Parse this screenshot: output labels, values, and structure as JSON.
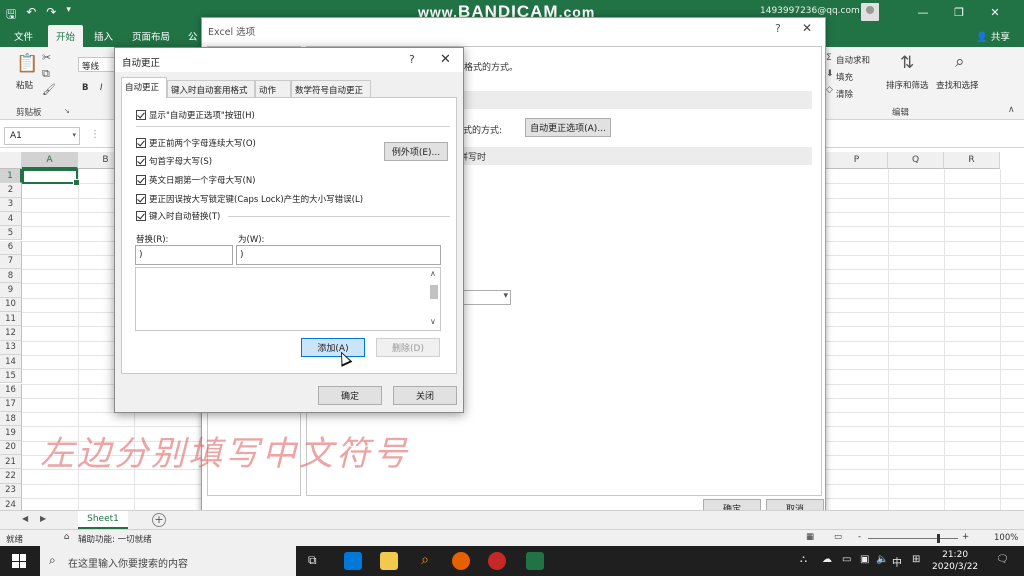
{
  "watermark": {
    "prefix": "www.",
    "brand": "BANDICAM",
    "suffix": ".com"
  },
  "account": "1493997236@qq.com",
  "window_buttons": [
    "—",
    "❐",
    "✕"
  ],
  "ribbon": {
    "tabs": [
      "文件",
      "开始",
      "插入",
      "页面布局",
      "公"
    ],
    "share": "共享",
    "paste": "粘贴",
    "clipboard_label": "剪贴板",
    "font_name": "等线",
    "autosum": "自动求和",
    "fill": "填充",
    "clear": "清除",
    "sort_filter": "排序和筛选",
    "find_select": "查找和选择",
    "editing_label": "编辑",
    "bold": "B",
    "italic": "I"
  },
  "formula_bar": {
    "name_box": "A1"
  },
  "grid": {
    "columns_left": [
      "A",
      "B"
    ],
    "columns_right": [
      "P",
      "Q",
      "R"
    ],
    "rows": [
      "1",
      "2",
      "3",
      "4",
      "5",
      "6",
      "7",
      "8",
      "9",
      "10",
      "11",
      "12",
      "13",
      "14",
      "15",
      "16",
      "17",
      "18",
      "19",
      "20",
      "21",
      "22",
      "23",
      "24"
    ]
  },
  "overlay_caption": "左边分别填写中文符号",
  "sheet_tab": "Sheet1",
  "add_sheet": "+",
  "status": {
    "ready": "就绪",
    "accessibility": "辅助功能: 一切就绪",
    "zoom": "100%",
    "minus": "-",
    "plus": "+"
  },
  "taskbar": {
    "search_placeholder": "在这里输入你要搜索的内容",
    "tray_lang": "中",
    "time": "21:20",
    "date": "2020/3/22"
  },
  "options_dialog": {
    "title": "Excel 选项",
    "help": "?",
    "close": "✕",
    "text_format": "格式的方式。",
    "text_method": "格式的方式:",
    "autocorrect_options_button": "自动更正选项(A)...",
    "band_2": "拼写时",
    "ok": "确定",
    "cancel": "取消"
  },
  "autocorrect_dialog": {
    "title": "自动更正",
    "help": "?",
    "close": "✕",
    "tabs": [
      "自动更正",
      "键入时自动套用格式",
      "动作",
      "数学符号自动更正"
    ],
    "show_buttons": "显示\"自动更正选项\"按钮(H)",
    "options": [
      "更正前两个字母连续大写(O)",
      "句首字母大写(S)",
      "英文日期第一个字母大写(N)",
      "更正因误按大写锁定键(Caps Lock)产生的大小写错误(L)"
    ],
    "exceptions_button": "例外项(E)...",
    "replace_as_you_type": "键入时自动替换(T)",
    "replace_label": "替换(R):",
    "with_label": "为(W):",
    "replace_value": ")",
    "with_value": ")",
    "add_button": "添加(A)",
    "delete_button": "删除(D)",
    "ok": "确定",
    "close_button": "关闭"
  }
}
